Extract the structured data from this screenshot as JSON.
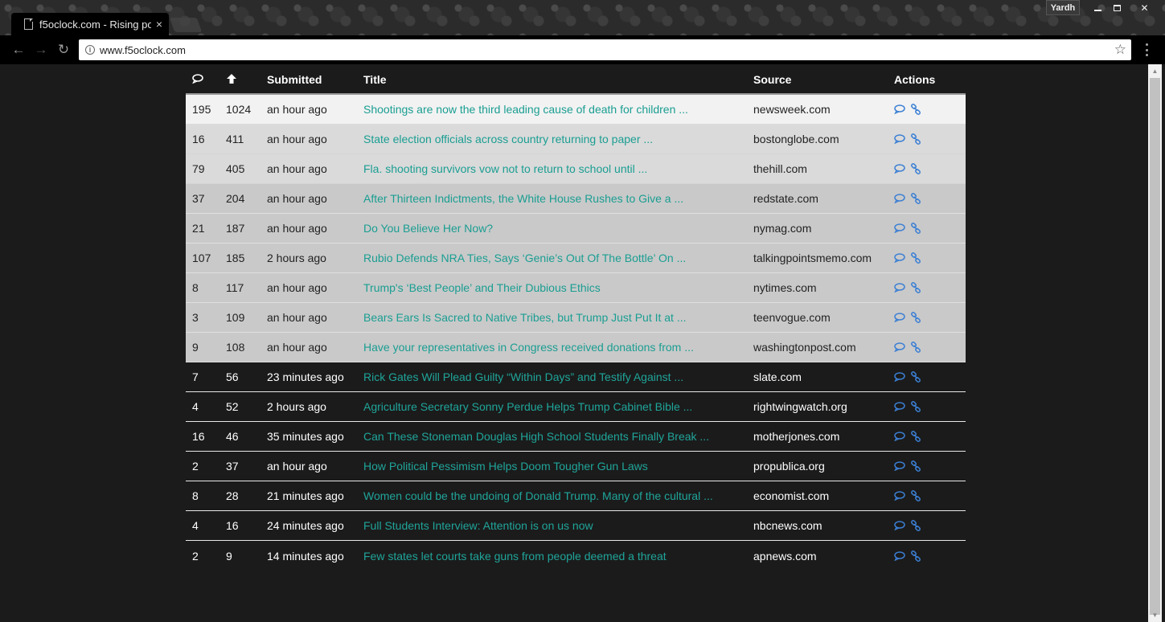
{
  "browser": {
    "tab_title": "f5oclock.com - Rising po",
    "tab_close": "×",
    "profile": "Yardh",
    "window_close": "✕",
    "url": "www.f5oclock.com",
    "back": "←",
    "forward": "→",
    "reload": "↻",
    "star": "☆",
    "info": "i"
  },
  "table": {
    "headers": {
      "comments_icon": "speech-bubble-icon",
      "upvotes_icon": "arrow-up-icon",
      "submitted": "Submitted",
      "title": "Title",
      "source": "Source",
      "actions": "Actions"
    },
    "rows": [
      {
        "comments": "195",
        "upvotes": "1024",
        "submitted": "an hour ago",
        "title": "Shootings are now the third leading cause of death for children ...",
        "source": "newsweek.com"
      },
      {
        "comments": "16",
        "upvotes": "411",
        "submitted": "an hour ago",
        "title": "State election officials across country returning to paper ...",
        "source": "bostonglobe.com"
      },
      {
        "comments": "79",
        "upvotes": "405",
        "submitted": "an hour ago",
        "title": "Fla. shooting survivors vow not to return to school until ...",
        "source": "thehill.com"
      },
      {
        "comments": "37",
        "upvotes": "204",
        "submitted": "an hour ago",
        "title": "After Thirteen Indictments, the White House Rushes to Give a ...",
        "source": "redstate.com"
      },
      {
        "comments": "21",
        "upvotes": "187",
        "submitted": "an hour ago",
        "title": "Do You Believe Her Now?",
        "source": "nymag.com"
      },
      {
        "comments": "107",
        "upvotes": "185",
        "submitted": "2 hours ago",
        "title": "Rubio Defends NRA Ties, Says ‘Genie’s Out Of The Bottle’ On ...",
        "source": "talkingpointsmemo.com"
      },
      {
        "comments": "8",
        "upvotes": "117",
        "submitted": "an hour ago",
        "title": "Trump's ‘Best People’ and Their Dubious Ethics",
        "source": "nytimes.com"
      },
      {
        "comments": "3",
        "upvotes": "109",
        "submitted": "an hour ago",
        "title": "Bears Ears Is Sacred to Native Tribes, but Trump Just Put It at ...",
        "source": "teenvogue.com"
      },
      {
        "comments": "9",
        "upvotes": "108",
        "submitted": "an hour ago",
        "title": "Have your representatives in Congress received donations from ...",
        "source": "washingtonpost.com"
      },
      {
        "comments": "7",
        "upvotes": "56",
        "submitted": "23 minutes ago",
        "title": "Rick Gates Will Plead Guilty “Within Days” and Testify Against ...",
        "source": "slate.com"
      },
      {
        "comments": "4",
        "upvotes": "52",
        "submitted": "2 hours ago",
        "title": "Agriculture Secretary Sonny Perdue Helps Trump Cabinet Bible ...",
        "source": "rightwingwatch.org"
      },
      {
        "comments": "16",
        "upvotes": "46",
        "submitted": "35 minutes ago",
        "title": "Can These Stoneman Douglas High School Students Finally Break ...",
        "source": "motherjones.com"
      },
      {
        "comments": "2",
        "upvotes": "37",
        "submitted": "an hour ago",
        "title": "How Political Pessimism Helps Doom Tougher Gun Laws",
        "source": "propublica.org"
      },
      {
        "comments": "8",
        "upvotes": "28",
        "submitted": "21 minutes ago",
        "title": "Women could be the undoing of Donald Trump. Many of the cultural ...",
        "source": "economist.com"
      },
      {
        "comments": "4",
        "upvotes": "16",
        "submitted": "24 minutes ago",
        "title": "Full Students Interview: Attention is on us now",
        "source": "nbcnews.com"
      },
      {
        "comments": "2",
        "upvotes": "9",
        "submitted": "14 minutes ago",
        "title": "Few states let courts take guns from people deemed a threat",
        "source": "apnews.com"
      }
    ]
  },
  "colors": {
    "title_link": "#1fa59a",
    "action_icon": "#3b7fd4",
    "page_bg": "#1b1b1b"
  }
}
